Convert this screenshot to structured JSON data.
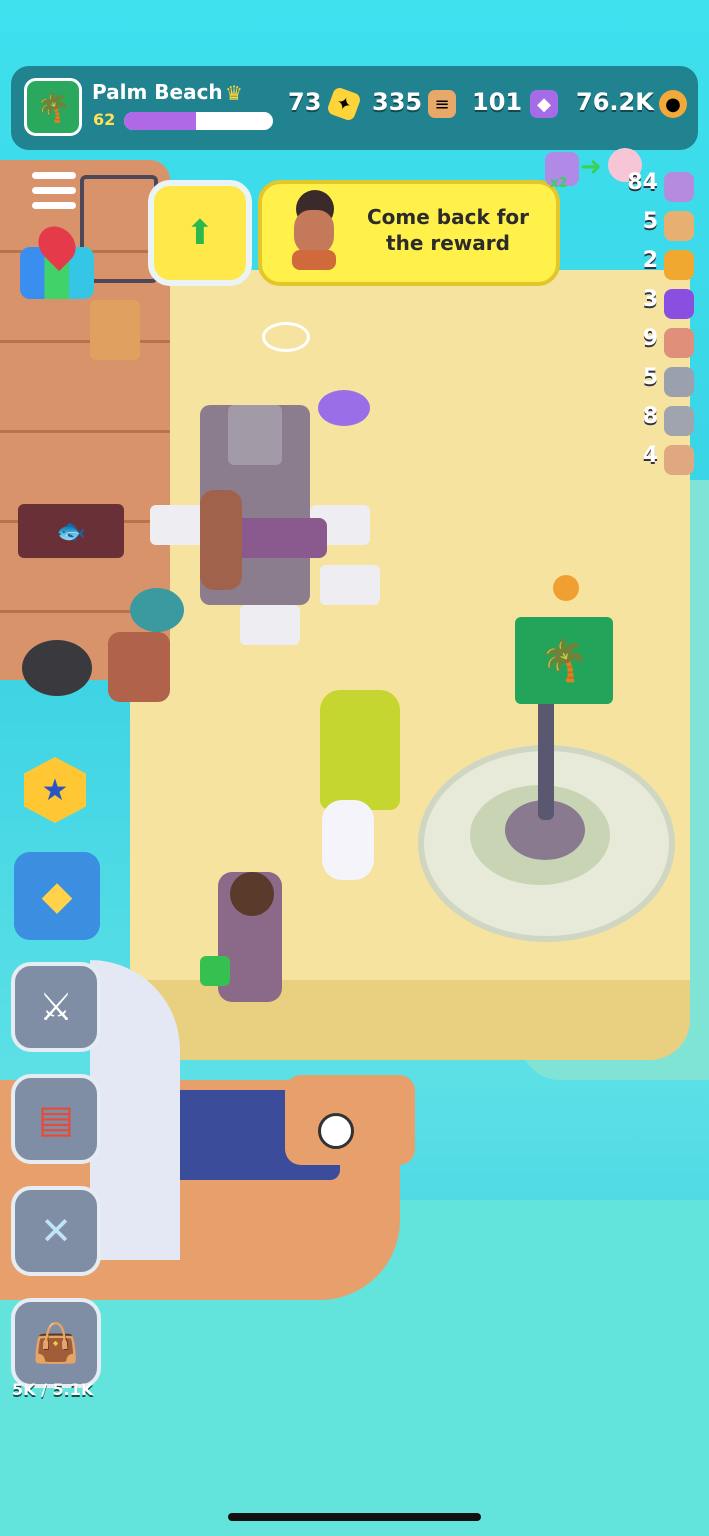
{
  "hud": {
    "island_name": "Palm Beach",
    "level": "62",
    "xp_progress": 0.48,
    "island_icon": "palm-tree-icon",
    "resources": [
      {
        "value": "73",
        "icon": "ticket-icon",
        "color": "#ffd33a"
      },
      {
        "value": "335",
        "icon": "scroll-icon",
        "color": "#e8a86a"
      },
      {
        "value": "101",
        "icon": "gem-icon",
        "color": "#a66be6"
      },
      {
        "value": "76.2K",
        "icon": "coin-icon",
        "color": "#f2a93a"
      }
    ]
  },
  "quest_banner": {
    "text_line1": "Come back for",
    "text_line2": "the reward"
  },
  "side_buttons": {
    "bag_capacity": "5K / 5.1K"
  },
  "inventory": [
    {
      "count": "84",
      "icon": "octopus-icon",
      "color": "#b58be0"
    },
    {
      "count": "5",
      "icon": "treasure-map-icon",
      "color": "#e8b070"
    },
    {
      "count": "2",
      "icon": "gear-icon",
      "color": "#f0a830"
    },
    {
      "count": "3",
      "icon": "lightning-icon",
      "color": "#8a4ee0"
    },
    {
      "count": "9",
      "icon": "rope-icon",
      "color": "#e0907a"
    },
    {
      "count": "5",
      "icon": "spring-icon",
      "color": "#9aa0ae"
    },
    {
      "count": "8",
      "icon": "iron-bar-icon",
      "color": "#a0a4ae"
    },
    {
      "count": "4",
      "icon": "leather-icon",
      "color": "#e0a880"
    }
  ],
  "boost_badge": "x2",
  "colors": {
    "hud_bg": "#1f7f8a",
    "banner_bg": "#fff04a",
    "sand": "#f6e3a0",
    "flag_green": "#22a55a"
  }
}
